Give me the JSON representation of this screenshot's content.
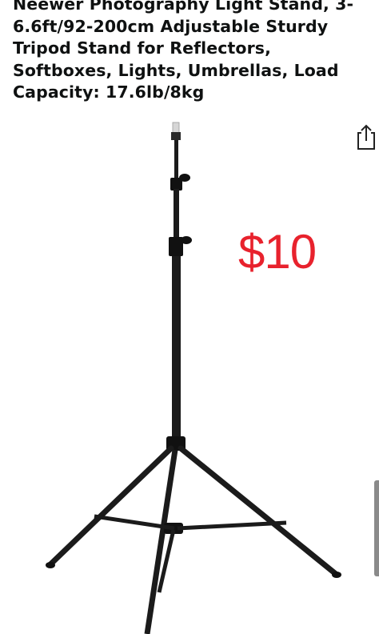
{
  "product": {
    "title": "Neewer Photography Light Stand, 3-6.6ft/92-200cm Adjustable Sturdy Tripod Stand for Reflectors, Softboxes, Lights, Umbrellas, Load Capacity: 17.6lb/8kg",
    "price_overlay": "$10",
    "image_icon": "light-stand-tripod"
  },
  "toolbar": {
    "share_icon": "share-icon"
  },
  "colors": {
    "title_text": "#0f1111",
    "price": "#e8222d",
    "stand": "#1b1b1b"
  }
}
